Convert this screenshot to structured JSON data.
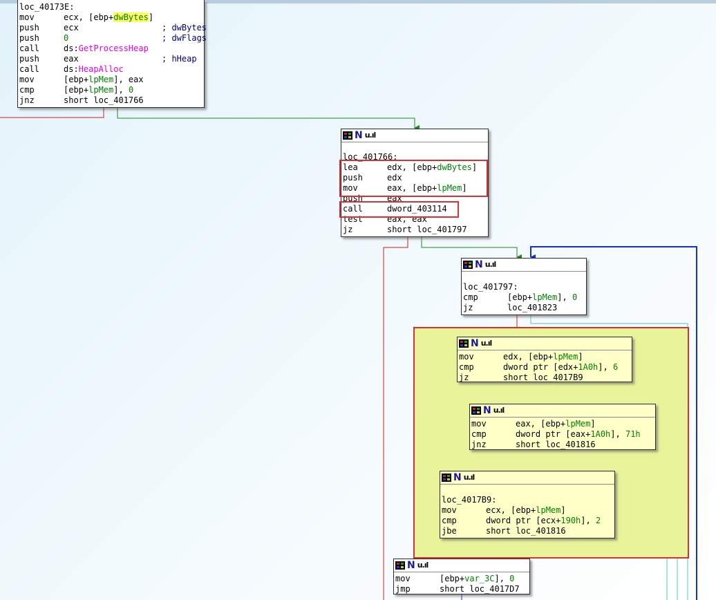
{
  "colors": {
    "edge_false": "#d02020",
    "edge_true": "#1a8a1a",
    "edge_loop": "#1030d0",
    "edge_gray": "#4fc9b5",
    "group_fill": "#e8f39a",
    "group_border": "#d83030",
    "func_name": "#e000e0",
    "var_name": "#008000",
    "highlight_var": "#ffff60",
    "number": "#008000"
  },
  "icons": [
    "block-grid-icon",
    "block-n-icon",
    "block-graph-icon"
  ],
  "blocks": {
    "b1": {
      "label": "loc_40173E:",
      "lines": [
        {
          "m": "mov",
          "a": [
            {
              "t": "ecx, [ebp+"
            },
            {
              "t": "dwBytes",
              "c": "var",
              "hl": true
            },
            {
              "t": "]"
            }
          ]
        },
        {
          "m": "push",
          "a": [
            {
              "t": "ecx"
            }
          ],
          "cm": "; dwBytes"
        },
        {
          "m": "push",
          "a": [
            {
              "t": "0",
              "c": "num"
            }
          ],
          "cm": "; dwFlags"
        },
        {
          "m": "call",
          "a": [
            {
              "t": "ds:"
            },
            {
              "t": "GetProcessHeap",
              "c": "fn"
            }
          ]
        },
        {
          "m": "push",
          "a": [
            {
              "t": "eax"
            }
          ],
          "cm": "; hHeap"
        },
        {
          "m": "call",
          "a": [
            {
              "t": "ds:"
            },
            {
              "t": "HeapAlloc",
              "c": "fn"
            }
          ]
        },
        {
          "m": "mov",
          "a": [
            {
              "t": "[ebp+"
            },
            {
              "t": "lpMem",
              "c": "var"
            },
            {
              "t": "], eax"
            }
          ]
        },
        {
          "m": "cmp",
          "a": [
            {
              "t": "[ebp+"
            },
            {
              "t": "lpMem",
              "c": "var"
            },
            {
              "t": "], "
            },
            {
              "t": "0",
              "c": "num"
            }
          ]
        },
        {
          "m": "jnz",
          "a": [
            {
              "t": "short loc_401766"
            }
          ]
        }
      ]
    },
    "b2": {
      "label": "loc_401766:",
      "lines": [
        {
          "m": "lea",
          "a": [
            {
              "t": "edx, [ebp+"
            },
            {
              "t": "dwBytes",
              "c": "var"
            },
            {
              "t": "]"
            }
          ]
        },
        {
          "m": "push",
          "a": [
            {
              "t": "edx"
            }
          ]
        },
        {
          "m": "mov",
          "a": [
            {
              "t": "eax, [ebp+"
            },
            {
              "t": "lpMem",
              "c": "var"
            },
            {
              "t": "]"
            }
          ]
        },
        {
          "m": "push",
          "a": [
            {
              "t": "eax"
            }
          ]
        },
        {
          "m": "call",
          "a": [
            {
              "t": "dword_403114"
            }
          ]
        },
        {
          "m": "test",
          "a": [
            {
              "t": "eax, eax"
            }
          ]
        },
        {
          "m": "jz",
          "a": [
            {
              "t": "short loc_401797"
            }
          ]
        }
      ]
    },
    "b3": {
      "label": "loc_401797:",
      "lines": [
        {
          "m": "cmp",
          "a": [
            {
              "t": "[ebp+"
            },
            {
              "t": "lpMem",
              "c": "var"
            },
            {
              "t": "], "
            },
            {
              "t": "0",
              "c": "num"
            }
          ]
        },
        {
          "m": "jz",
          "a": [
            {
              "t": "loc_401823"
            }
          ]
        }
      ]
    },
    "b4": {
      "label": "",
      "lines": [
        {
          "m": "mov",
          "a": [
            {
              "t": "edx, [ebp+"
            },
            {
              "t": "lpMem",
              "c": "var"
            },
            {
              "t": "]"
            }
          ]
        },
        {
          "m": "cmp",
          "a": [
            {
              "t": "dword ptr [edx+"
            },
            {
              "t": "1A0h",
              "c": "num"
            },
            {
              "t": "], "
            },
            {
              "t": "6",
              "c": "num"
            }
          ]
        },
        {
          "m": "jz",
          "a": [
            {
              "t": "short loc_4017B9"
            }
          ]
        }
      ]
    },
    "b5": {
      "label": "",
      "lines": [
        {
          "m": "mov",
          "a": [
            {
              "t": "eax, [ebp+"
            },
            {
              "t": "lpMem",
              "c": "var"
            },
            {
              "t": "]"
            }
          ]
        },
        {
          "m": "cmp",
          "a": [
            {
              "t": "dword ptr [eax+"
            },
            {
              "t": "1A0h",
              "c": "num"
            },
            {
              "t": "], "
            },
            {
              "t": "71h",
              "c": "num"
            }
          ]
        },
        {
          "m": "jnz",
          "a": [
            {
              "t": "short loc_401816"
            }
          ]
        }
      ]
    },
    "b6": {
      "label": "loc_4017B9:",
      "lines": [
        {
          "m": "mov",
          "a": [
            {
              "t": "ecx, [ebp+"
            },
            {
              "t": "lpMem",
              "c": "var"
            },
            {
              "t": "]"
            }
          ]
        },
        {
          "m": "cmp",
          "a": [
            {
              "t": "dword ptr [ecx+"
            },
            {
              "t": "190h",
              "c": "num"
            },
            {
              "t": "], "
            },
            {
              "t": "2",
              "c": "num"
            }
          ]
        },
        {
          "m": "jbe",
          "a": [
            {
              "t": "short loc_401816"
            }
          ]
        }
      ]
    },
    "b7": {
      "label": "",
      "lines": [
        {
          "m": "mov",
          "a": [
            {
              "t": "[ebp+"
            },
            {
              "t": "var_3C",
              "c": "var"
            },
            {
              "t": "], "
            },
            {
              "t": "0",
              "c": "num"
            }
          ]
        },
        {
          "m": "jmp",
          "a": [
            {
              "t": "short loc_4017D7"
            }
          ]
        }
      ]
    }
  }
}
